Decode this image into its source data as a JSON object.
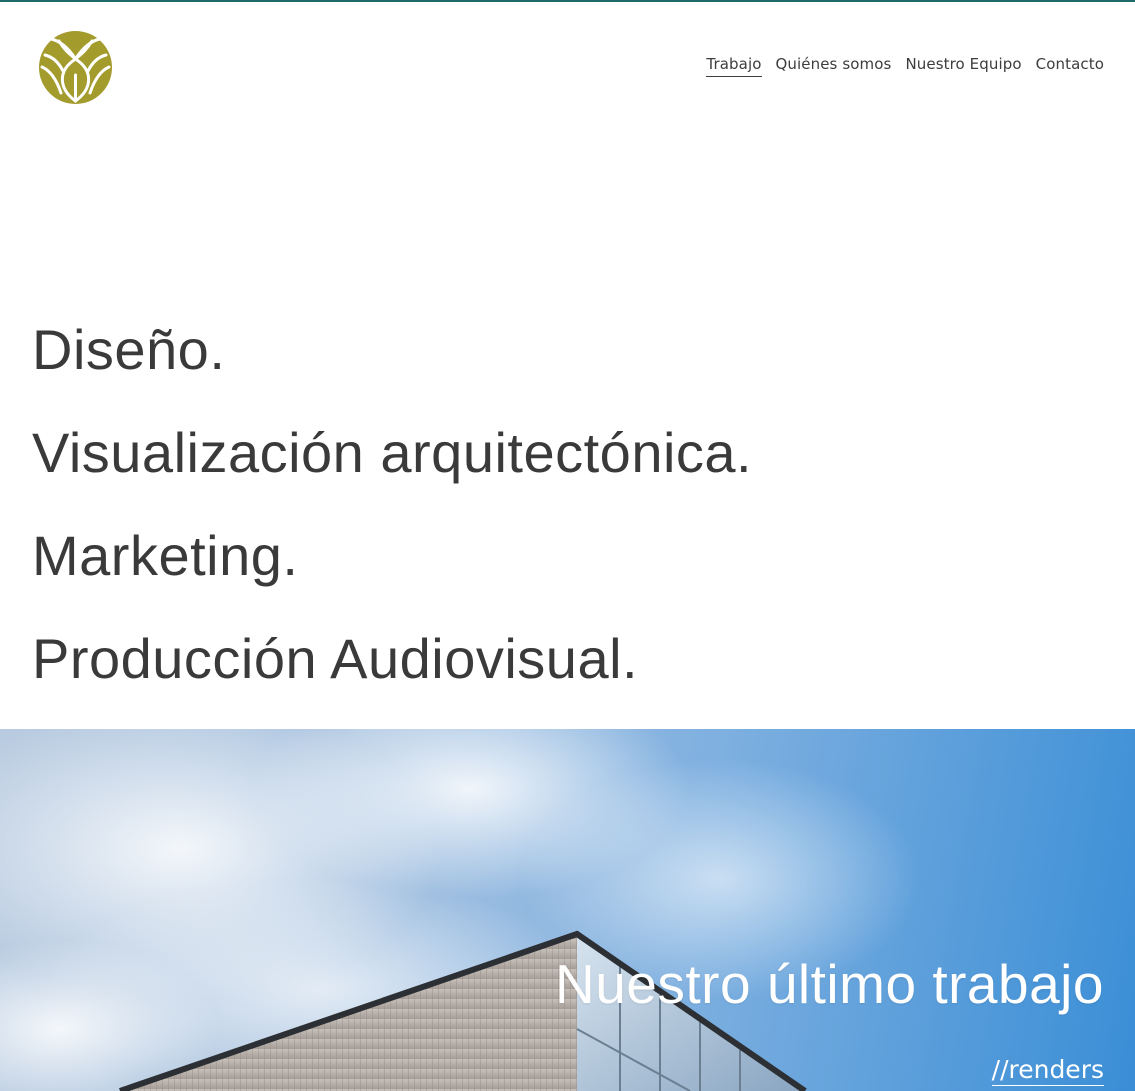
{
  "header": {
    "logo_name": "artichoke-logo",
    "accent_color": "#a39b2c",
    "nav": [
      {
        "label": "Trabajo",
        "active": true
      },
      {
        "label": "Quiénes somos",
        "active": false
      },
      {
        "label": "Nuestro Equipo",
        "active": false
      },
      {
        "label": "Contacto",
        "active": false
      }
    ]
  },
  "services": [
    "Diseño.",
    "Visualización arquitectónica.",
    "Marketing.",
    "Producción Audiovisual."
  ],
  "hero": {
    "title": "Nuestro último trabajo",
    "link_label": "//renders"
  }
}
